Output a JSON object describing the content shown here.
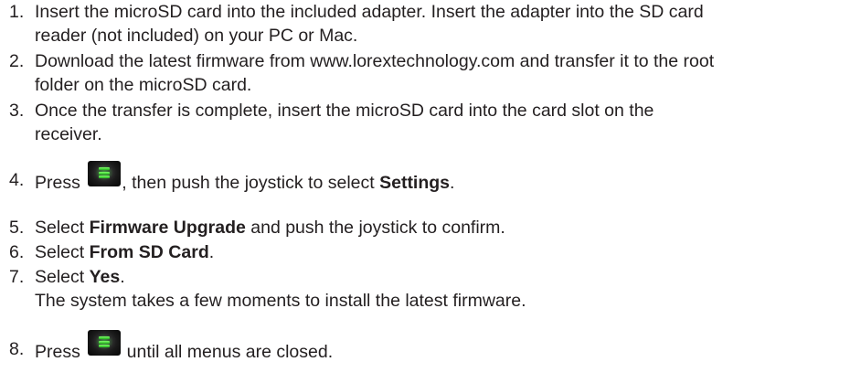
{
  "steps": [
    {
      "number": "1.",
      "lines": [
        "Insert the microSD card into the included adapter. Insert the adapter into the SD card",
        "reader (not included) on your PC or Mac."
      ]
    },
    {
      "number": "2.",
      "lines": [
        "Download the latest firmware from www.lorextechnology.com and transfer it to the root",
        "folder on the microSD card."
      ]
    },
    {
      "number": "3.",
      "lines": [
        "Once the transfer is complete, insert the microSD card into the card slot on the",
        "receiver."
      ]
    },
    {
      "number": "4.",
      "prefix": "Press ",
      "middle": ", then push the joystick to select ",
      "bold": "Settings",
      "suffix": "."
    },
    {
      "number": "5.",
      "prefix": "Select ",
      "bold": "Firmware Upgrade",
      "suffix": " and push the joystick to confirm."
    },
    {
      "number": "6.",
      "prefix": "Select ",
      "bold": "From SD Card",
      "suffix": "."
    },
    {
      "number": "7.",
      "prefix": "Select ",
      "bold": "Yes",
      "suffix": ".",
      "note": "The system takes a few moments to install the latest firmware."
    },
    {
      "number": "8.",
      "prefix": "Press ",
      "suffix": " until all menus are closed."
    }
  ],
  "icons": {
    "menu_button": "menu-button-icon"
  },
  "colors": {
    "text": "#231f20",
    "icon_green": "#3cd43a"
  }
}
